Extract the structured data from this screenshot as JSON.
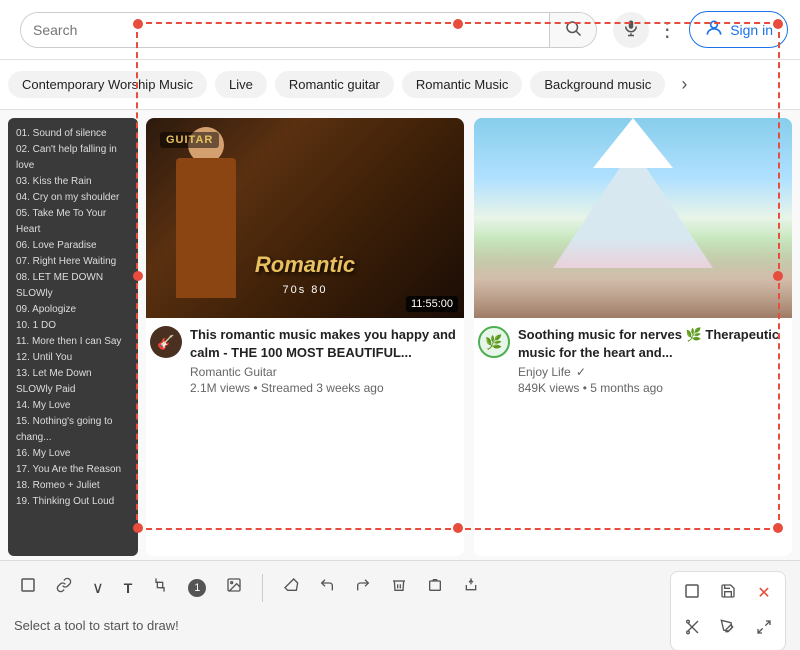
{
  "header": {
    "search_placeholder": "Search",
    "sign_in_label": "Sign in",
    "dots_icon": "⋮"
  },
  "filter_chips": [
    {
      "label": "Contemporary Worship Music",
      "active": false
    },
    {
      "label": "Live",
      "active": false
    },
    {
      "label": "Romantic guitar",
      "active": false
    },
    {
      "label": "Romantic Music",
      "active": false
    },
    {
      "label": "Background music",
      "active": false
    }
  ],
  "videos": [
    {
      "title": "This romantic music makes you happy and calm - THE 100 MOST BEAUTIFUL...",
      "channel": "Romantic Guitar",
      "views": "2.1M views",
      "time": "Streamed 3 weeks ago",
      "duration": "11:55:00",
      "guitar_label": "GUITAR"
    },
    {
      "title": "Soothing music for nerves 🌿 Therapeutic music for the heart and...",
      "channel": "Enjoy Life",
      "views": "849K views",
      "time": "5 months ago",
      "verified": true
    }
  ],
  "playlist_tracks": [
    "01. Sound of silence",
    "02. Can't help falling in love",
    "03. Kiss the Rain",
    "04. Cry on my shoulder",
    "05. Take Me To Your Heart",
    "06. Love Paradise",
    "07. Right Here Waiting",
    "08. LET ME DOWN SLOWly",
    "09. Apologize",
    "10. 1 DO",
    "11. More then I can Say",
    "12. Until You",
    "13. Let Me Down SLOWly Paid",
    "14. My Love",
    "15. Nothing's going to chang...",
    "16. My Love",
    "17. You Are the Reason",
    "18. Romeo + Juliet",
    "19. Thinking Out Loud"
  ],
  "guitar_subtitle": "70s 80",
  "guitar_title": "Romantic",
  "toolbar": {
    "hint": "Select a tool to start to draw!",
    "tools": [
      {
        "icon": "⬜",
        "name": "rectangle-tool"
      },
      {
        "icon": "🔗",
        "name": "link-tool"
      },
      {
        "icon": "∨",
        "name": "expand-tool"
      },
      {
        "icon": "T",
        "name": "text-tool"
      },
      {
        "icon": "✕",
        "name": "crop-tool"
      },
      {
        "icon": "①",
        "name": "number-tool"
      },
      {
        "icon": "🖼",
        "name": "image-tool"
      }
    ],
    "mini_tools": [
      {
        "icon": "⬜",
        "name": "mini-rect-tool"
      },
      {
        "icon": "💾",
        "name": "save-tool"
      },
      {
        "icon": "✕",
        "name": "close-tool"
      },
      {
        "icon": "✂",
        "name": "cut-tool"
      },
      {
        "icon": "✏",
        "name": "pen-tool"
      },
      {
        "icon": "⤢",
        "name": "fullscreen-tool"
      }
    ]
  }
}
